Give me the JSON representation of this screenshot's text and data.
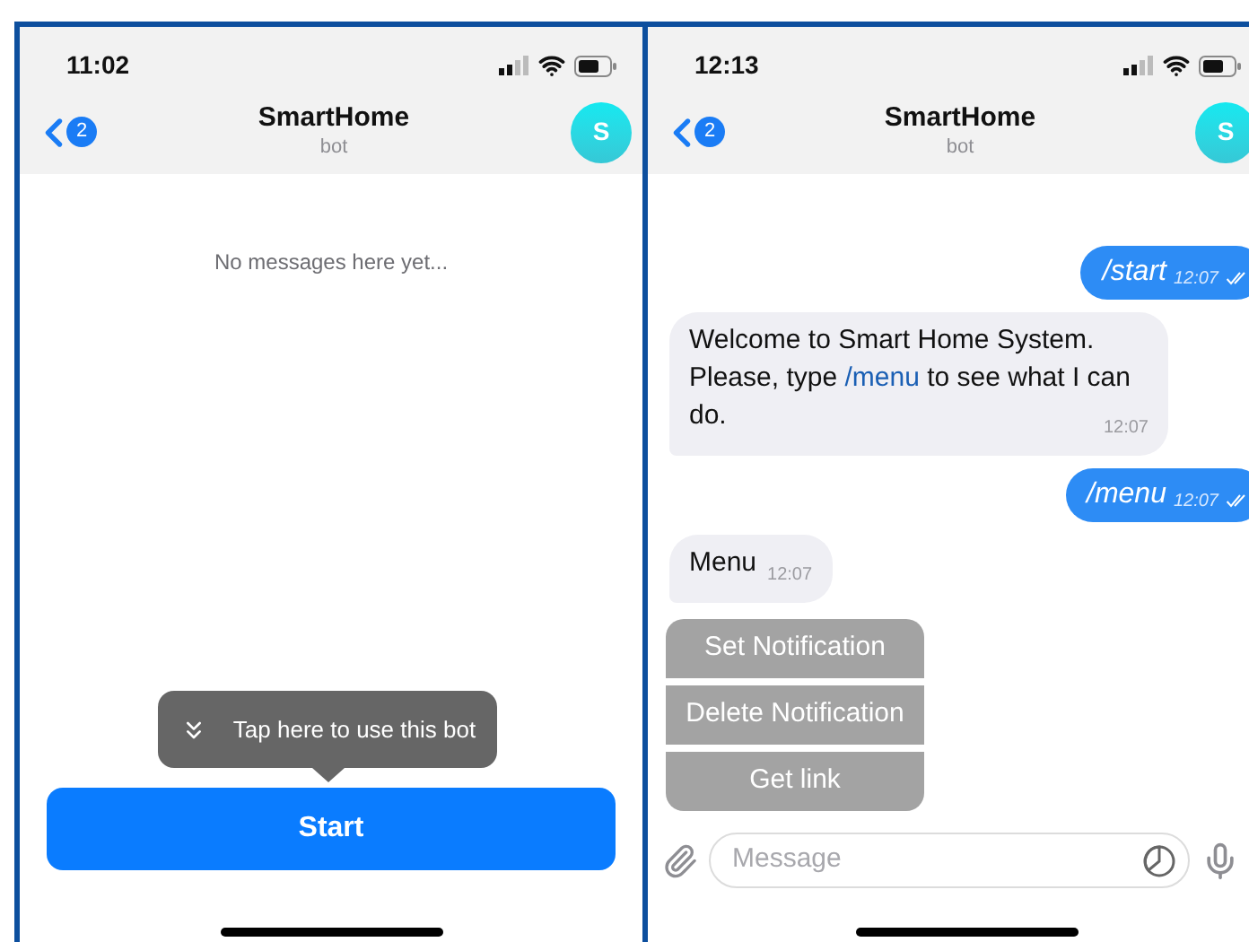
{
  "screens": [
    {
      "status_bar": {
        "time": "11:02"
      },
      "header": {
        "back_badge": "2",
        "title": "SmartHome",
        "subtitle": "bot",
        "avatar": "S"
      },
      "empty_text": "No messages here yet...",
      "tooltip": "Tap here to use this bot",
      "start_button": "Start"
    },
    {
      "status_bar": {
        "time": "12:13"
      },
      "header": {
        "back_badge": "2",
        "title": "SmartHome",
        "subtitle": "bot",
        "avatar": "S"
      },
      "messages": [
        {
          "kind": "outgoing",
          "parts": [
            {
              "kind": "plain",
              "text": "/start"
            }
          ],
          "time": "12:07",
          "read": true
        },
        {
          "kind": "incoming",
          "parts": [
            {
              "kind": "plain",
              "text": "Welcome to Smart Home System. Please, type "
            },
            {
              "kind": "link",
              "text": "/menu"
            },
            {
              "kind": "plain",
              "text": " to see what I can do."
            }
          ],
          "time": "12:07"
        },
        {
          "kind": "outgoing",
          "parts": [
            {
              "kind": "plain",
              "text": "/menu"
            }
          ],
          "time": "12:07",
          "read": true
        },
        {
          "kind": "incoming",
          "parts": [
            {
              "kind": "plain",
              "text": "Menu"
            }
          ],
          "time": "12:07"
        }
      ],
      "keyboard": [
        "Set Notification",
        "Delete Notification",
        "Get link"
      ],
      "composer": {
        "placeholder": "Message"
      }
    }
  ]
}
